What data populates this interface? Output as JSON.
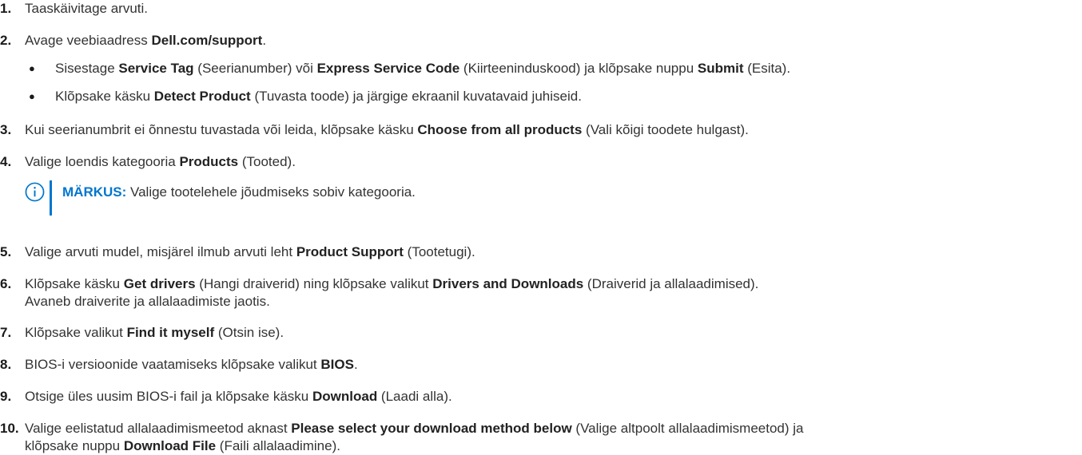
{
  "steps": [
    {
      "num": "1.",
      "parts": [
        {
          "t": "Taaskäivitage arvuti."
        }
      ]
    },
    {
      "num": "2.",
      "parts": [
        {
          "t": "Avage veebiaadress "
        },
        {
          "t": "Dell.com/support",
          "b": true
        },
        {
          "t": "."
        }
      ]
    },
    {
      "num": "3.",
      "parts": [
        {
          "t": "Kui seerianumbrit ei õnnestu tuvastada või leida, klõpsake käsku "
        },
        {
          "t": "Choose from all products",
          "b": true
        },
        {
          "t": " (Vali kõigi toodete hulgast)."
        }
      ]
    },
    {
      "num": "4.",
      "parts": [
        {
          "t": "Valige loendis kategooria "
        },
        {
          "t": "Products",
          "b": true
        },
        {
          "t": " (Tooted)."
        }
      ]
    },
    {
      "num": "5.",
      "parts": [
        {
          "t": "Valige arvuti mudel, misjärel ilmub arvuti leht "
        },
        {
          "t": "Product Support",
          "b": true
        },
        {
          "t": " (Tootetugi)."
        }
      ]
    },
    {
      "num": "6.",
      "parts": [
        {
          "t": "Klõpsake käsku "
        },
        {
          "t": "Get drivers",
          "b": true
        },
        {
          "t": " (Hangi draiverid) ning klõpsake valikut "
        },
        {
          "t": "Drivers and Downloads",
          "b": true
        },
        {
          "t": " (Draiverid ja allalaadimised)."
        }
      ],
      "line2": "Avaneb draiverite ja allalaadimiste jaotis."
    },
    {
      "num": "7.",
      "parts": [
        {
          "t": "Klõpsake valikut "
        },
        {
          "t": "Find it myself",
          "b": true
        },
        {
          "t": " (Otsin ise)."
        }
      ]
    },
    {
      "num": "8.",
      "parts": [
        {
          "t": "BIOS-i versioonide vaatamiseks klõpsake valikut "
        },
        {
          "t": "BIOS",
          "b": true
        },
        {
          "t": "."
        }
      ]
    },
    {
      "num": "9.",
      "parts": [
        {
          "t": "Otsige üles uusim BIOS-i fail ja klõpsake käsku "
        },
        {
          "t": "Download",
          "b": true
        },
        {
          "t": " (Laadi alla)."
        }
      ]
    },
    {
      "num": "10.",
      "parts": [
        {
          "t": "Valige eelistatud allalaadimismeetod aknast "
        },
        {
          "t": "Please select your download method below",
          "b": true
        },
        {
          "t": " (Valige altpoolt allalaadimismeetod) ja"
        }
      ],
      "line2parts": [
        {
          "t": "klõpsake nuppu "
        },
        {
          "t": "Download File",
          "b": true
        },
        {
          "t": " (Faili allalaadimine)."
        }
      ]
    }
  ],
  "substeps": [
    {
      "bullet": "●",
      "parts": [
        {
          "t": "Sisestage "
        },
        {
          "t": "Service Tag",
          "b": true
        },
        {
          "t": " (Seerianumber) või "
        },
        {
          "t": "Express Service Code",
          "b": true
        },
        {
          "t": " (Kiirteeninduskood) ja klõpsake nuppu "
        },
        {
          "t": "Submit",
          "b": true
        },
        {
          "t": " (Esita)."
        }
      ]
    },
    {
      "bullet": "●",
      "parts": [
        {
          "t": "Klõpsake käsku "
        },
        {
          "t": "Detect Product",
          "b": true
        },
        {
          "t": " (Tuvasta toode) ja järgige ekraanil kuvatavaid juhiseid."
        }
      ]
    }
  ],
  "note": {
    "label": "MÄRKUS:",
    "text": " Valige tootelehele jõudmiseks sobiv kategooria.",
    "icon": "info-icon",
    "accent": "#0076ce"
  }
}
